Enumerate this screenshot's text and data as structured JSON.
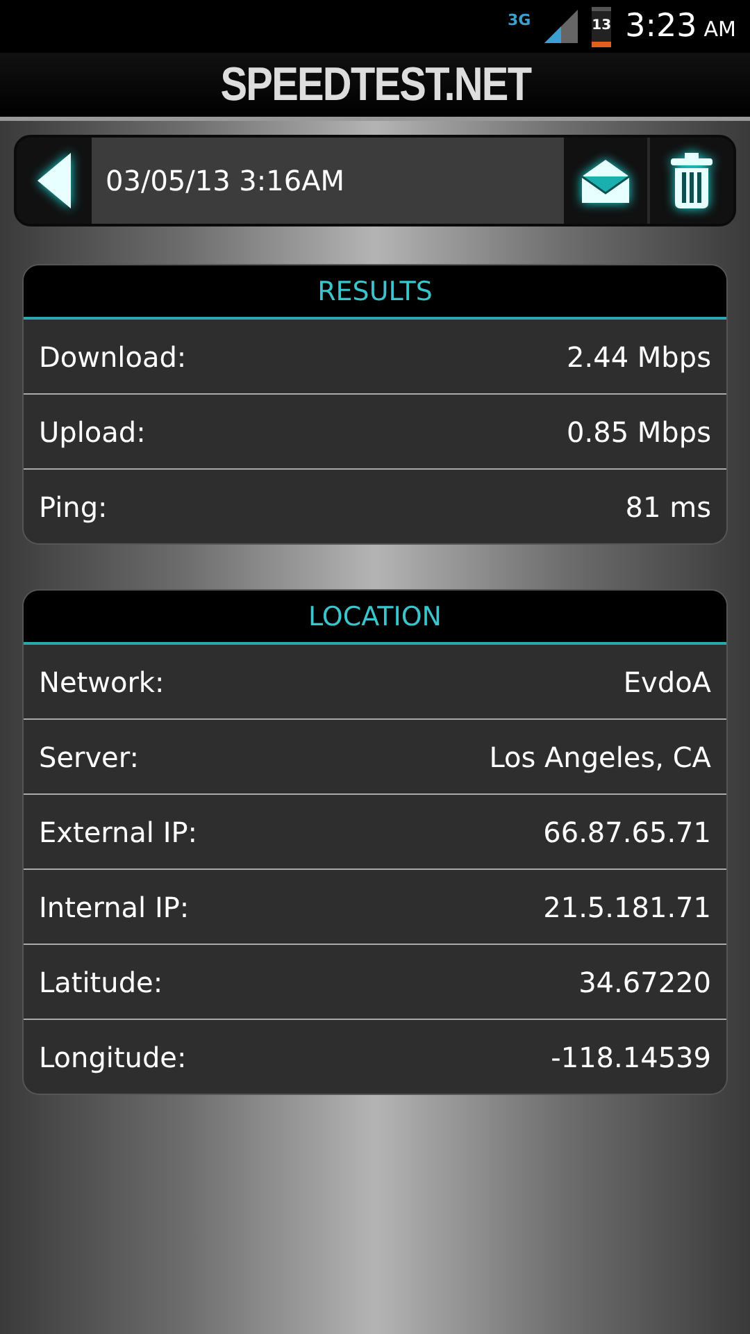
{
  "status_bar": {
    "network": "3G",
    "battery": "13",
    "time": "3:23",
    "meridiem": "AM"
  },
  "app_title": "SPEEDTEST.NET",
  "toolbar": {
    "date": "03/05/13 3:16AM"
  },
  "sections": [
    {
      "title": "RESULTS",
      "rows": [
        {
          "label": "Download:",
          "value": "2.44 Mbps"
        },
        {
          "label": "Upload:",
          "value": "0.85 Mbps"
        },
        {
          "label": "Ping:",
          "value": "81 ms"
        }
      ]
    },
    {
      "title": "LOCATION",
      "rows": [
        {
          "label": "Network:",
          "value": "EvdoA"
        },
        {
          "label": "Server:",
          "value": "Los Angeles, CA"
        },
        {
          "label": "External IP:",
          "value": "66.87.65.71"
        },
        {
          "label": "Internal IP:",
          "value": "21.5.181.71"
        },
        {
          "label": "Latitude:",
          "value": "34.67220"
        },
        {
          "label": "Longitude:",
          "value": "-118.14539"
        }
      ]
    }
  ]
}
